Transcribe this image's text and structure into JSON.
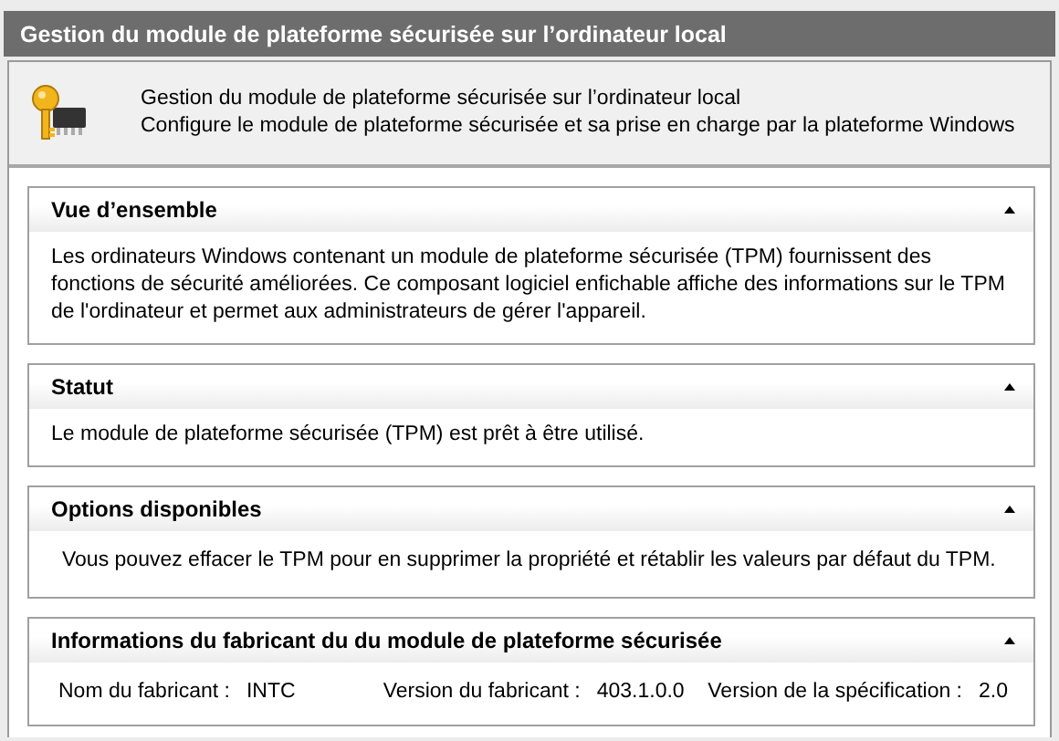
{
  "window": {
    "title": "Gestion du module de plateforme sécurisée sur l’ordinateur local"
  },
  "header": {
    "title": "Gestion du module de plateforme sécurisée sur l’ordinateur local",
    "subtitle": "Configure le module de plateforme sécurisée et sa prise en charge par la plateforme Windows"
  },
  "sections": [
    {
      "kind": "text",
      "title": "Vue d’ensemble",
      "expanded": true,
      "text": "Les ordinateurs Windows contenant un module de plateforme sécurisée (TPM) fournissent des fonctions de sécurité améliorées. Ce composant logiciel enfichable affiche des informations sur le TPM de l'ordinateur et permet aux administrateurs de gérer l'appareil."
    },
    {
      "kind": "text",
      "title": "Statut",
      "expanded": true,
      "text": "Le module de plateforme sécurisée (TPM) est prêt à être utilisé."
    },
    {
      "kind": "text",
      "title": "Options disponibles",
      "expanded": true,
      "text": "Vous pouvez effacer le TPM pour en supprimer la propriété et rétablir les valeurs par défaut du TPM."
    },
    {
      "kind": "fields",
      "title": "Informations du fabricant du du module de plateforme sécurisée",
      "expanded": true,
      "fields": [
        {
          "label": "Nom du fabricant :",
          "value": "INTC"
        },
        {
          "label": "Version du fabricant :",
          "value": "403.1.0.0"
        },
        {
          "label": "Version de la spécification :",
          "value": "2.0"
        }
      ]
    }
  ]
}
